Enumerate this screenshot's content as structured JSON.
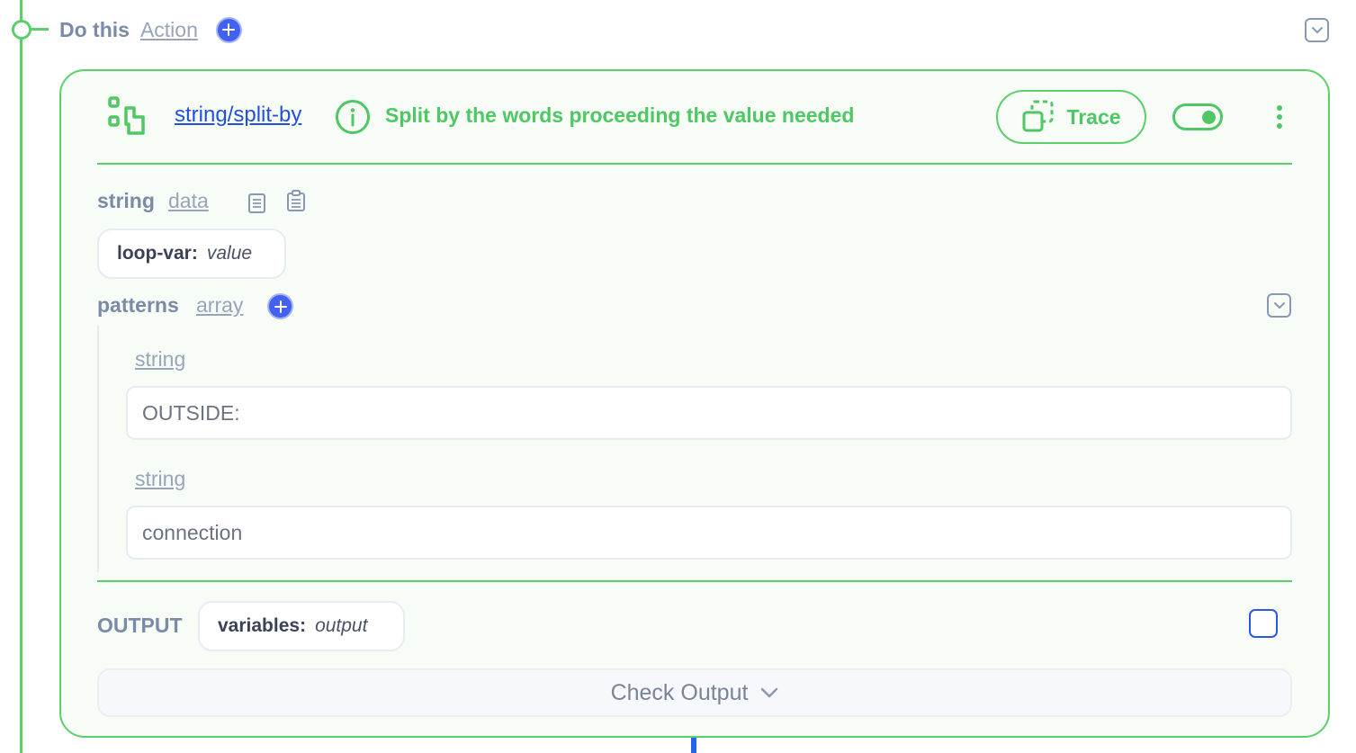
{
  "header": {
    "title": "Do this",
    "type_link": "Action"
  },
  "step": {
    "name": "string/split-by",
    "description": "Split by the words proceeding the value needed",
    "trace_label": "Trace",
    "enabled": true
  },
  "fields": {
    "string": {
      "label": "string",
      "type": "data",
      "chip_key": "loop-var:",
      "chip_value": "value"
    },
    "patterns": {
      "label": "patterns",
      "type": "array",
      "items": [
        {
          "type": "string",
          "value": "OUTSIDE:"
        },
        {
          "type": "string",
          "value": "connection"
        }
      ]
    }
  },
  "output": {
    "label": "OUTPUT",
    "chip_key": "variables:",
    "chip_value": "output",
    "check_label": "Check Output"
  },
  "colors": {
    "accent_green": "#5ccf6b",
    "link_blue": "#2250d9",
    "plus_blue": "#4361ee"
  },
  "icons": {
    "add": "plus-circle-icon",
    "collapse": "chevron-down-icon",
    "step": "workflow-nodes-icon",
    "info": "info-circle-icon",
    "trace": "trace-copy-icon",
    "more": "vertical-dots-icon",
    "copy": "copy-icon",
    "paste": "clipboard-icon"
  }
}
